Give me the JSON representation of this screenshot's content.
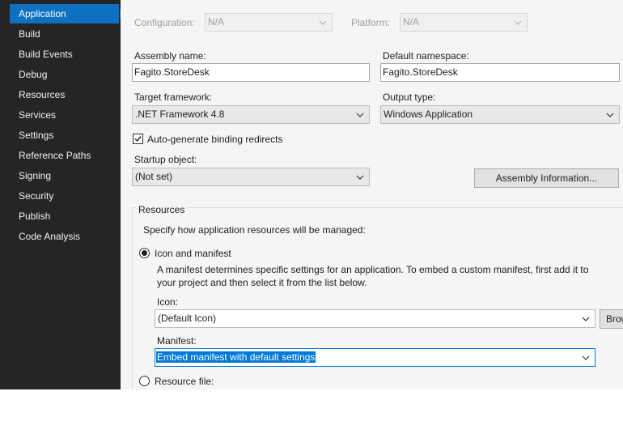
{
  "sidebar": {
    "items": [
      {
        "label": "Application",
        "active": true
      },
      {
        "label": "Build"
      },
      {
        "label": "Build Events"
      },
      {
        "label": "Debug"
      },
      {
        "label": "Resources"
      },
      {
        "label": "Services"
      },
      {
        "label": "Settings"
      },
      {
        "label": "Reference Paths"
      },
      {
        "label": "Signing"
      },
      {
        "label": "Security"
      },
      {
        "label": "Publish"
      },
      {
        "label": "Code Analysis"
      }
    ]
  },
  "top": {
    "configuration_label": "Configuration:",
    "configuration_value": "N/A",
    "platform_label": "Platform:",
    "platform_value": "N/A"
  },
  "form": {
    "assembly_name_label": "Assembly name:",
    "assembly_name_value": "Fagito.StoreDesk",
    "default_namespace_label": "Default namespace:",
    "default_namespace_value": "Fagito.StoreDesk",
    "target_framework_label": "Target framework:",
    "target_framework_value": ".NET Framework 4.8",
    "output_type_label": "Output type:",
    "output_type_value": "Windows Application",
    "binding_redirects_label": "Auto-generate binding redirects",
    "binding_redirects_checked": true,
    "startup_object_label": "Startup object:",
    "startup_object_value": "(Not set)",
    "assembly_info_button": "Assembly Information..."
  },
  "resources": {
    "group_title": "Resources",
    "description": "Specify how application resources will be managed:",
    "icon_manifest_label": "Icon and manifest",
    "icon_manifest_help_line1": "A manifest determines specific settings for an application. To embed a custom manifest, first add it to",
    "icon_manifest_help_line2": "your project and then select it from the list below.",
    "icon_label": "Icon:",
    "icon_value": "(Default Icon)",
    "browse_button": "Browse...",
    "manifest_label": "Manifest:",
    "manifest_value": "Embed manifest with default settings",
    "resource_file_label": "Resource file:"
  },
  "colors": {
    "sidebar_bg": "#252526",
    "accent": "#0e70c0",
    "content_bg": "#f5f5f5"
  }
}
